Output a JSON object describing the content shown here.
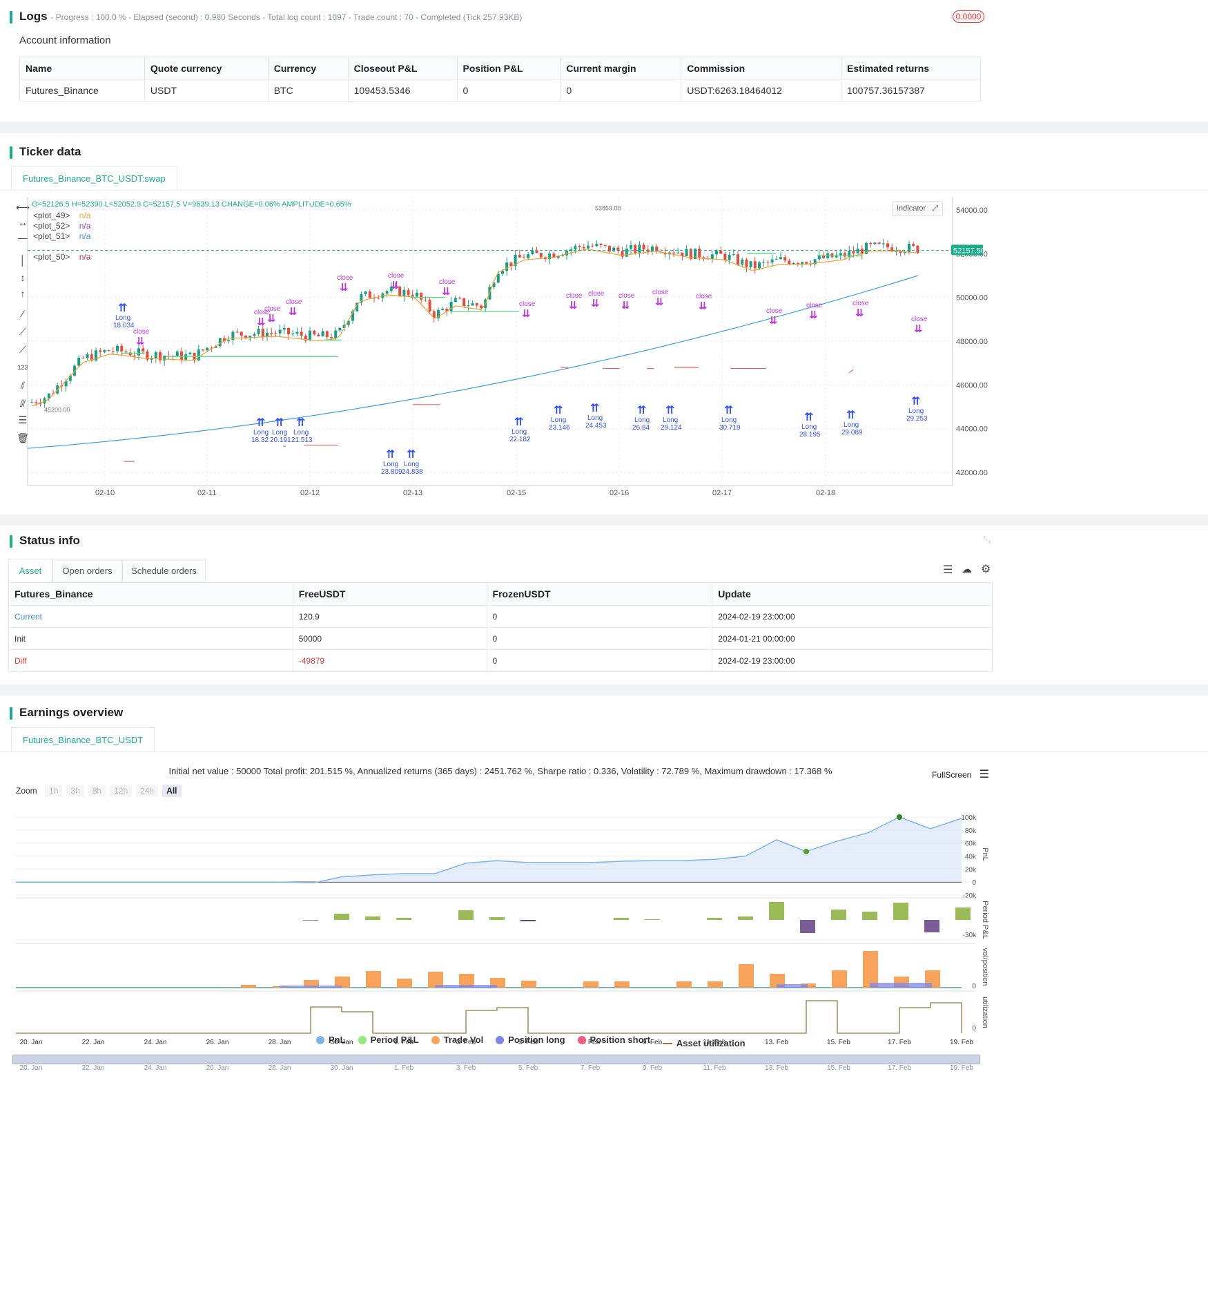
{
  "logs": {
    "title": "Logs",
    "status": "- Progress : 100.0 % - Elapsed (second) : 0.980  Seconds - Total log count : 1097 - Trade count : 70 - Completed (Tick 257.93KB)",
    "badge": "0.0000"
  },
  "account": {
    "heading": "Account information",
    "columns": [
      "Name",
      "Quote currency",
      "Currency",
      "Closeout P&L",
      "Position P&L",
      "Current margin",
      "Commission",
      "Estimated returns"
    ],
    "row": [
      "Futures_Binance",
      "USDT",
      "BTC",
      "109453.5346",
      "0",
      "0",
      "USDT:6263.18464012",
      "100757.36157387"
    ]
  },
  "ticker": {
    "title": "Ticker data",
    "tab": "Futures_Binance_BTC_USDT:swap",
    "ohlc": "O=52126.5 H=52390 L=52052.9 C=52157.5 V=9639.13 CHANGE=0.06% AMPLITUDE=0.65%",
    "plots": [
      {
        "label": "<plot_49>",
        "value": "n/a",
        "color": "#f0a030"
      },
      {
        "label": "<plot_52>",
        "value": "n/a",
        "color": "#9b3fb5"
      },
      {
        "label": "<plot_51>",
        "value": "n/a",
        "color": "#3b8ff3"
      },
      {
        "label": "<plot_50>",
        "value": "n/a",
        "color": "#c83040"
      }
    ],
    "indicator_btn": "Indicator",
    "price_tag": "52157.50",
    "low_label": "45200.00",
    "high_label": "53859.00",
    "y_ticks": [
      "54000.00",
      "52000.00",
      "50000.00",
      "48000.00",
      "46000.00",
      "44000.00",
      "42000.00"
    ],
    "x_ticks": [
      "02-10",
      "02-11",
      "02-12",
      "02-13",
      "02-15",
      "02-16",
      "02-17",
      "02-18"
    ],
    "trade_labels": [
      "18.034",
      "18.32",
      "20.191",
      "21.513",
      "23.809",
      "24.838",
      "22.182",
      "23.146",
      "24.453",
      "26.84",
      "29.124",
      "30.719",
      "28.195",
      "29.089",
      "29.253"
    ],
    "long_text": "Long",
    "close_text": "close"
  },
  "status": {
    "title": "Status info",
    "tabs": [
      "Asset",
      "Open orders",
      "Schedule orders"
    ],
    "columns": [
      "Futures_Binance",
      "FreeUSDT",
      "FrozenUSDT",
      "Update"
    ],
    "rows": [
      [
        "Current",
        "120.9",
        "0",
        "2024-02-19 23:00:00"
      ],
      [
        "Init",
        "50000",
        "0",
        "2024-01-21 00:00:00"
      ],
      [
        "Diff",
        "-49879",
        "0",
        "2024-02-19 23:00:00"
      ]
    ]
  },
  "earnings": {
    "title": "Earnings overview",
    "tab": "Futures_Binance_BTC_USDT",
    "summary": "Initial net value : 50000 Total profit: 201.515 %, Annualized returns (365 days) : 2451.762 %, Sharpe ratio : 0.336, Volatility : 72.789 %, Maximum drawdown : 17.368 %",
    "fullscreen": "FullScreen",
    "zoom_label": "Zoom",
    "zoom_opts": [
      "1h",
      "3h",
      "8h",
      "12h",
      "24h",
      "All"
    ],
    "pnl_ticks": [
      "100k",
      "80k",
      "60k",
      "40k",
      "20k",
      "0",
      "-20k"
    ],
    "period_tick": "-30k",
    "vol_tick": "0",
    "util_tick": "0",
    "axis_titles": [
      "PnL",
      "Period P&L",
      "vol/position",
      "utilization"
    ],
    "x_ticks": [
      "20. Jan",
      "22. Jan",
      "24. Jan",
      "26. Jan",
      "28. Jan",
      "30. Jan",
      "1. Feb",
      "3. Feb",
      "5. Feb",
      "7. Feb",
      "9. Feb",
      "11. Feb",
      "13. Feb",
      "15. Feb",
      "17. Feb",
      "19. Feb"
    ],
    "legend": [
      {
        "label": "PnL",
        "color": "#7cb5ec"
      },
      {
        "label": "Period P&L",
        "color": "#90ed7d"
      },
      {
        "label": "Trade Vol",
        "color": "#f7a35c"
      },
      {
        "label": "Position long",
        "color": "#8085e9"
      },
      {
        "label": "Position short",
        "color": "#f15c80"
      },
      {
        "label": "Asset utilization",
        "color": "#8d7a3c"
      }
    ]
  }
}
